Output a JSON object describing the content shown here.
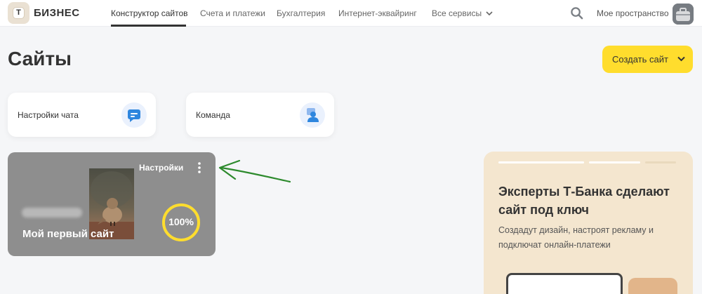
{
  "header": {
    "logo_letter": "Т",
    "brand": "БИЗНЕС",
    "nav": [
      {
        "label": "Конструктор сайтов",
        "active": true
      },
      {
        "label": "Счета и платежи",
        "active": false
      },
      {
        "label": "Бухгалтерия",
        "active": false
      },
      {
        "label": "Интернет-эквайринг",
        "active": false
      },
      {
        "label": "Все сервисы",
        "active": false,
        "has_dropdown": true
      }
    ],
    "search_icon": "search-icon",
    "workspace": "Мое пространство"
  },
  "main": {
    "title": "Сайты",
    "create_button": "Создать сайт",
    "cards": [
      {
        "label": "Настройки чата",
        "icon": "chat-icon"
      },
      {
        "label": "Команда",
        "icon": "team-icon"
      }
    ],
    "site": {
      "settings_label": "Настройки",
      "name": "Мой первый сайт",
      "progress_label": "100%",
      "progress": 1.0
    }
  },
  "promo": {
    "title": "Эксперты Т-Банка сделают сайт под ключ",
    "text": "Создадут дизайн, настроят рекламу и подключат онлайн-платежи"
  },
  "colors": {
    "accent": "#ffdd2d",
    "background": "#f5f6f8",
    "tile": "#8e8e8e",
    "progress_ring": "#ffdd2d",
    "arrow": "#2d8a2d",
    "promo_bg": "#f4e6cf",
    "icon_blue": "#2e86de"
  }
}
